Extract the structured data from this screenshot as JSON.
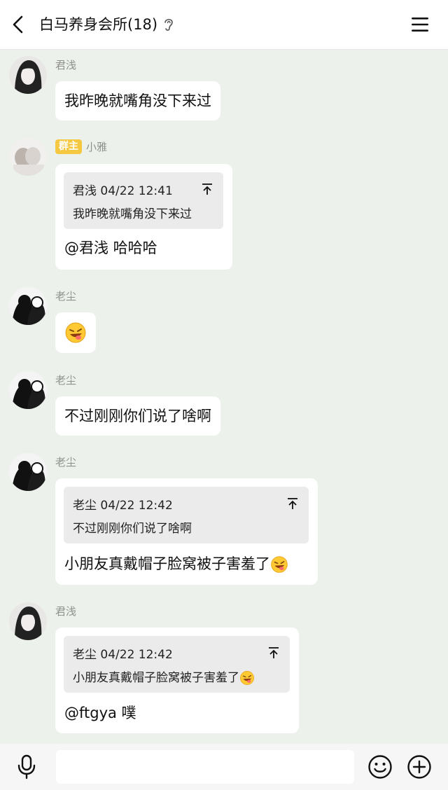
{
  "header": {
    "title": "白马养身会所(18)"
  },
  "messages": [
    {
      "sender": "君浅",
      "text": "我昨晚就嘴角没下来过"
    },
    {
      "sender": "小雅",
      "badge": "群主",
      "quote": {
        "meta": "君浅 04/22 12:41",
        "text": "我昨晚就嘴角没下来过"
      },
      "text": "@君浅 哈哈哈"
    },
    {
      "sender": "老尘",
      "emoji": "laughing-tongue-emoji"
    },
    {
      "sender": "老尘",
      "text": "不过刚刚你们说了啥啊"
    },
    {
      "sender": "老尘",
      "quote": {
        "meta": "老尘 04/22 12:42",
        "text": "不过刚刚你们说了啥啊"
      },
      "text": "小朋友真戴帽子脸窝被子害羞了"
    },
    {
      "sender": "君浅",
      "quote": {
        "meta": "老尘 04/22 12:42",
        "text": "小朋友真戴帽子脸窝被子害羞了"
      },
      "text": "@ftgya 噗"
    }
  ],
  "input": {
    "value": ""
  },
  "colors": {
    "background": "#edf1ec",
    "badge": "#f5c842",
    "bubble": "#ffffff",
    "quote": "#ebebeb"
  }
}
